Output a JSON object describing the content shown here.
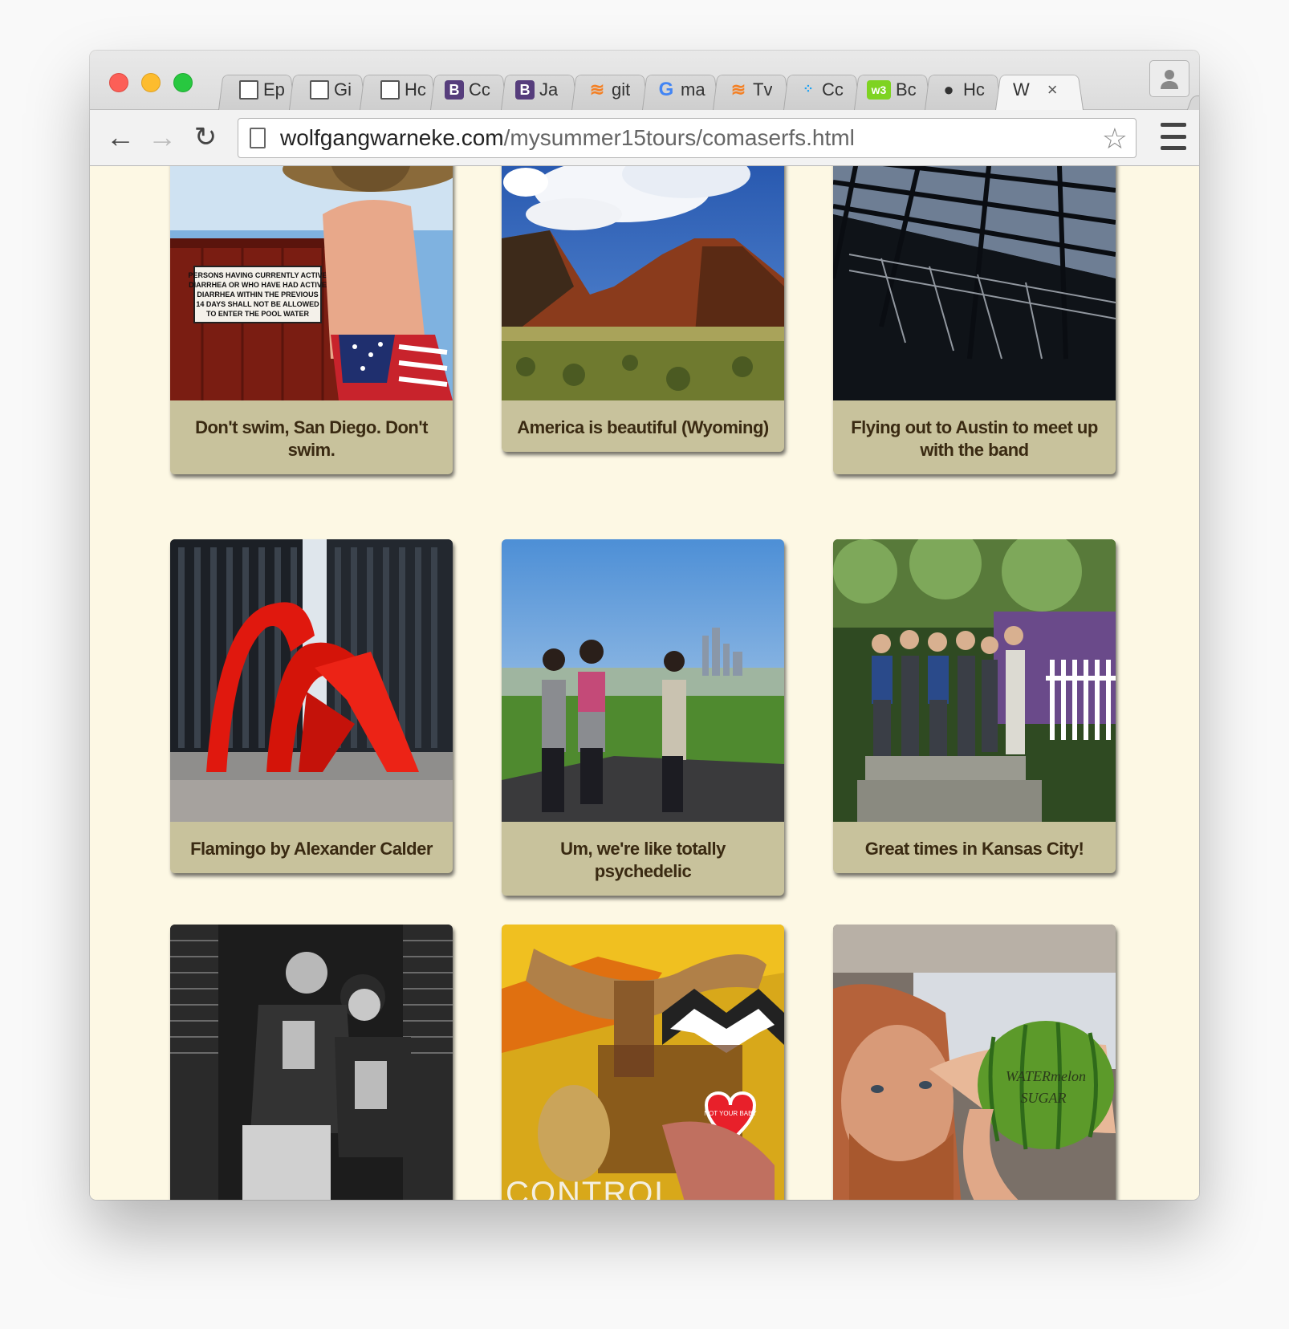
{
  "browser": {
    "tabs": [
      {
        "icon": "document-icon",
        "label": "Ep"
      },
      {
        "icon": "document-icon",
        "label": "Gi"
      },
      {
        "icon": "document-icon",
        "label": "Hc"
      },
      {
        "icon": "bootstrap-icon",
        "label": "Cc"
      },
      {
        "icon": "bootstrap-icon",
        "label": "Ja"
      },
      {
        "icon": "stackoverflow-icon",
        "label": "git"
      },
      {
        "icon": "google-icon",
        "label": "ma"
      },
      {
        "icon": "stackoverflow-icon",
        "label": "Tv"
      },
      {
        "icon": "dots-icon",
        "label": "Cc"
      },
      {
        "icon": "w3-icon",
        "label": "Bc"
      },
      {
        "icon": "apple-icon",
        "label": "Hc"
      },
      {
        "icon": "none",
        "label": "W",
        "active": true
      }
    ],
    "url_domain": "wolfgangwarneke.com",
    "url_path": "/mysummer15tours/comaserfs.html",
    "bootstrap_letter": "B",
    "google_letter": "G",
    "w3_text": "w3",
    "apple_glyph": "",
    "close_glyph": "×",
    "star_glyph": "☆",
    "profile_glyph": "👤",
    "back_glyph": "←",
    "forward_glyph": "→",
    "reload_glyph": "↻"
  },
  "gallery": {
    "cards": [
      {
        "caption": "Don't swim, San Diego. Don't swim.",
        "sign": [
          "PERSONS HAVING CURRENTLY ACTIVE",
          "DIARRHEA OR WHO HAVE HAD ACTIVE",
          "DIARRHEA WITHIN THE PREVIOUS",
          "14 DAYS SHALL NOT BE ALLOWED",
          "TO ENTER THE POOL WATER"
        ]
      },
      {
        "caption": "America is beautiful (Wyoming)"
      },
      {
        "caption": "Flying out to Austin to meet up with the band"
      },
      {
        "caption": "Flamingo by Alexander Calder"
      },
      {
        "caption": "Um, we're like totally psychedelic"
      },
      {
        "caption": "Great times in Kansas City!"
      },
      {
        "caption": ""
      },
      {
        "caption": "",
        "mural_text": "CONTROL",
        "heart_text": "NOT YOUR BABY"
      },
      {
        "caption": "",
        "melon_text": [
          "WATERmelon",
          "SUGAR"
        ]
      }
    ]
  },
  "colors": {
    "page_bg": "#fdf8e4",
    "card_bg": "#c8c29c",
    "caption_text": "#3a2a12"
  }
}
